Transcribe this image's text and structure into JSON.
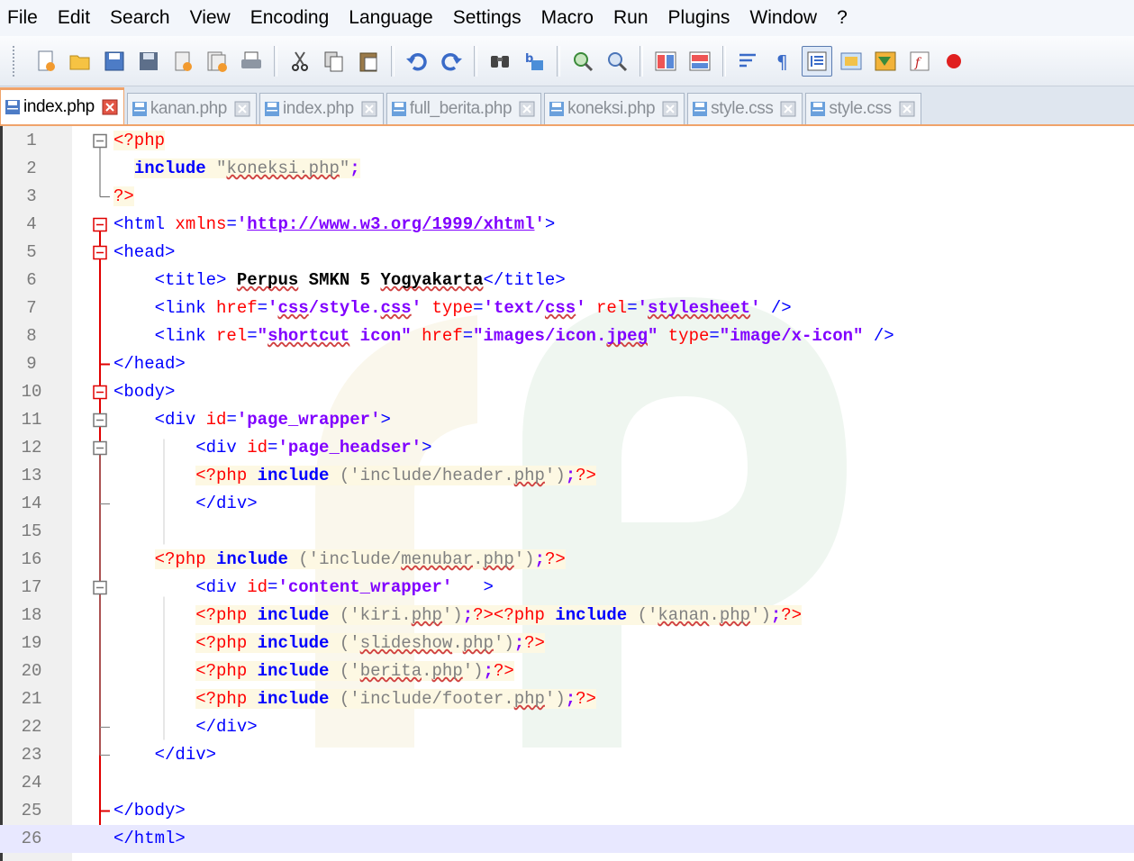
{
  "menu": [
    "File",
    "Edit",
    "Search",
    "View",
    "Encoding",
    "Language",
    "Settings",
    "Macro",
    "Run",
    "Plugins",
    "Window",
    "?"
  ],
  "toolbar_icons": [
    "new-icon",
    "open-icon",
    "save-icon",
    "save-all-icon",
    "close-icon",
    "close-all-icon",
    "print-icon",
    "cut-icon",
    "copy-icon",
    "paste-icon",
    "undo-icon",
    "redo-icon",
    "find-icon",
    "replace-icon",
    "zoom-in-icon",
    "zoom-out-icon",
    "sync-vertical-icon",
    "sync-horizontal-icon",
    "word-wrap-icon",
    "show-all-chars-icon",
    "indent-guide-icon",
    "define-language-icon",
    "document-map-icon",
    "function-list-icon",
    "record-macro-icon"
  ],
  "tabs": [
    {
      "label": "index.php",
      "active": true
    },
    {
      "label": "kanan.php",
      "active": false
    },
    {
      "label": "index.php",
      "active": false
    },
    {
      "label": "full_berita.php",
      "active": false
    },
    {
      "label": "koneksi.php",
      "active": false
    },
    {
      "label": "style.css",
      "active": false
    },
    {
      "label": "style.css",
      "active": false
    }
  ],
  "colors": {
    "accent_tab": "#f0a36a",
    "current_line": "#e8e8ff",
    "fold_line": "#e00000"
  },
  "code_lines": [
    {
      "n": "1",
      "tokens": [
        [
          "php",
          "<?php"
        ]
      ]
    },
    {
      "n": "2",
      "tokens": [
        [
          "plain",
          "  "
        ],
        [
          "kw",
          "include"
        ],
        [
          "str",
          " \""
        ],
        [
          "strsq",
          "koneksi.php"
        ],
        [
          "str",
          "\""
        ],
        [
          "pun",
          ";"
        ]
      ]
    },
    {
      "n": "3",
      "tokens": [
        [
          "php",
          "?>"
        ]
      ]
    },
    {
      "n": "4",
      "tokens": [
        [
          "tag",
          "<html "
        ],
        [
          "attr",
          "xmlns"
        ],
        [
          "tag",
          "="
        ],
        [
          "val",
          "'"
        ],
        [
          "url",
          "http://www.w3.org/1999/xhtml"
        ],
        [
          "val",
          "'"
        ],
        [
          "tag",
          ">"
        ]
      ]
    },
    {
      "n": "5",
      "tokens": [
        [
          "tag",
          "<head>"
        ]
      ]
    },
    {
      "n": "6",
      "tokens": [
        [
          "plain",
          "    "
        ],
        [
          "tag",
          "<title>"
        ],
        [
          "txtc",
          " "
        ],
        [
          "txtsq",
          "Perpus"
        ],
        [
          "txtc",
          " SMKN 5 "
        ],
        [
          "txtsq",
          "Yogyakarta"
        ],
        [
          "tag",
          "</title>"
        ]
      ]
    },
    {
      "n": "7",
      "tokens": [
        [
          "plain",
          "    "
        ],
        [
          "tag",
          "<link "
        ],
        [
          "attr",
          "href"
        ],
        [
          "tag",
          "="
        ],
        [
          "val",
          "'"
        ],
        [
          "valsq",
          "css"
        ],
        [
          "val",
          "/style."
        ],
        [
          "valsq",
          "css"
        ],
        [
          "val",
          "'"
        ],
        [
          "tag",
          " "
        ],
        [
          "attr",
          "type"
        ],
        [
          "tag",
          "="
        ],
        [
          "val",
          "'text/"
        ],
        [
          "valsq",
          "css"
        ],
        [
          "val",
          "'"
        ],
        [
          "tag",
          " "
        ],
        [
          "attr",
          "rel"
        ],
        [
          "tag",
          "="
        ],
        [
          "val",
          "'"
        ],
        [
          "valsq",
          "stylesheet"
        ],
        [
          "val",
          "'"
        ],
        [
          "tag",
          " />"
        ]
      ]
    },
    {
      "n": "8",
      "tokens": [
        [
          "plain",
          "    "
        ],
        [
          "tag",
          "<link "
        ],
        [
          "attr",
          "rel"
        ],
        [
          "tag",
          "="
        ],
        [
          "val",
          "\""
        ],
        [
          "valsq",
          "shortcut"
        ],
        [
          "val",
          " icon\""
        ],
        [
          "tag",
          " "
        ],
        [
          "attr",
          "href"
        ],
        [
          "tag",
          "="
        ],
        [
          "val",
          "\"images/icon."
        ],
        [
          "valsq",
          "jpeg"
        ],
        [
          "val",
          "\""
        ],
        [
          "tag",
          " "
        ],
        [
          "attr",
          "type"
        ],
        [
          "tag",
          "="
        ],
        [
          "val",
          "\"image/x-icon\""
        ],
        [
          "tag",
          " />"
        ]
      ]
    },
    {
      "n": "9",
      "tokens": [
        [
          "tag",
          "</head>"
        ]
      ]
    },
    {
      "n": "10",
      "tokens": [
        [
          "tag",
          "<body>"
        ]
      ]
    },
    {
      "n": "11",
      "tokens": [
        [
          "plain",
          "    "
        ],
        [
          "tag",
          "<div "
        ],
        [
          "attr",
          "id"
        ],
        [
          "tag",
          "="
        ],
        [
          "val",
          "'page_wrapper'"
        ],
        [
          "tag",
          ">"
        ]
      ]
    },
    {
      "n": "12",
      "tokens": [
        [
          "plain",
          "        "
        ],
        [
          "tag",
          "<div "
        ],
        [
          "attr",
          "id"
        ],
        [
          "tag",
          "="
        ],
        [
          "val",
          "'page_headser'"
        ],
        [
          "tag",
          ">"
        ]
      ]
    },
    {
      "n": "13",
      "tokens": [
        [
          "plain",
          "        "
        ],
        [
          "php",
          "<?php"
        ],
        [
          "plainb",
          " "
        ],
        [
          "kw",
          "include"
        ],
        [
          "str",
          " ('include/header."
        ],
        [
          "strsq",
          "php"
        ],
        [
          "str",
          "')"
        ],
        [
          "pun",
          ";"
        ],
        [
          "php",
          "?>"
        ]
      ]
    },
    {
      "n": "14",
      "tokens": [
        [
          "plain",
          "        "
        ],
        [
          "tag",
          "</div>"
        ]
      ]
    },
    {
      "n": "15",
      "tokens": []
    },
    {
      "n": "16",
      "tokens": [
        [
          "plain",
          "    "
        ],
        [
          "php",
          "<?php"
        ],
        [
          "plainb",
          " "
        ],
        [
          "kw",
          "include"
        ],
        [
          "str",
          " ('include/"
        ],
        [
          "strsq",
          "menubar"
        ],
        [
          "str",
          "."
        ],
        [
          "strsq",
          "php"
        ],
        [
          "str",
          "')"
        ],
        [
          "pun",
          ";"
        ],
        [
          "php",
          "?>"
        ]
      ]
    },
    {
      "n": "17",
      "tokens": [
        [
          "plain",
          "        "
        ],
        [
          "tag",
          "<div "
        ],
        [
          "attr",
          "id"
        ],
        [
          "tag",
          "="
        ],
        [
          "val",
          "'content_wrapper'"
        ],
        [
          "tag",
          "   >"
        ]
      ]
    },
    {
      "n": "18",
      "tokens": [
        [
          "plain",
          "        "
        ],
        [
          "php",
          "<?php"
        ],
        [
          "plainb",
          " "
        ],
        [
          "kw",
          "include"
        ],
        [
          "str",
          " ('kiri."
        ],
        [
          "strsq",
          "php"
        ],
        [
          "str",
          "')"
        ],
        [
          "pun",
          ";"
        ],
        [
          "php",
          "?><?php"
        ],
        [
          "plainb",
          " "
        ],
        [
          "kw",
          "include"
        ],
        [
          "str",
          " ('"
        ],
        [
          "strsq",
          "kanan"
        ],
        [
          "str",
          "."
        ],
        [
          "strsq",
          "php"
        ],
        [
          "str",
          "')"
        ],
        [
          "pun",
          ";"
        ],
        [
          "php",
          "?>"
        ]
      ]
    },
    {
      "n": "19",
      "tokens": [
        [
          "plain",
          "        "
        ],
        [
          "php",
          "<?php"
        ],
        [
          "plainb",
          " "
        ],
        [
          "kw",
          "include"
        ],
        [
          "str",
          " ('"
        ],
        [
          "strsq",
          "slideshow"
        ],
        [
          "str",
          "."
        ],
        [
          "strsq",
          "php"
        ],
        [
          "str",
          "')"
        ],
        [
          "pun",
          ";"
        ],
        [
          "php",
          "?>"
        ]
      ]
    },
    {
      "n": "20",
      "tokens": [
        [
          "plain",
          "        "
        ],
        [
          "php",
          "<?php"
        ],
        [
          "plainb",
          " "
        ],
        [
          "kw",
          "include"
        ],
        [
          "str",
          " ('"
        ],
        [
          "strsq",
          "berita"
        ],
        [
          "str",
          "."
        ],
        [
          "strsq",
          "php"
        ],
        [
          "str",
          "')"
        ],
        [
          "pun",
          ";"
        ],
        [
          "php",
          "?>"
        ]
      ]
    },
    {
      "n": "21",
      "tokens": [
        [
          "plain",
          "        "
        ],
        [
          "php",
          "<?php"
        ],
        [
          "plainb",
          " "
        ],
        [
          "kw",
          "include"
        ],
        [
          "str",
          " ('include/footer."
        ],
        [
          "strsq",
          "php"
        ],
        [
          "str",
          "')"
        ],
        [
          "pun",
          ";"
        ],
        [
          "php",
          "?>"
        ]
      ]
    },
    {
      "n": "22",
      "tokens": [
        [
          "plain",
          "        "
        ],
        [
          "tag",
          "</div>"
        ]
      ]
    },
    {
      "n": "23",
      "tokens": [
        [
          "plain",
          "    "
        ],
        [
          "tag",
          "</div>"
        ]
      ]
    },
    {
      "n": "24",
      "tokens": []
    },
    {
      "n": "25",
      "tokens": [
        [
          "tag",
          "</body>"
        ]
      ]
    },
    {
      "n": "26",
      "tokens": [
        [
          "tag",
          "</html>"
        ]
      ],
      "current": true
    }
  ]
}
